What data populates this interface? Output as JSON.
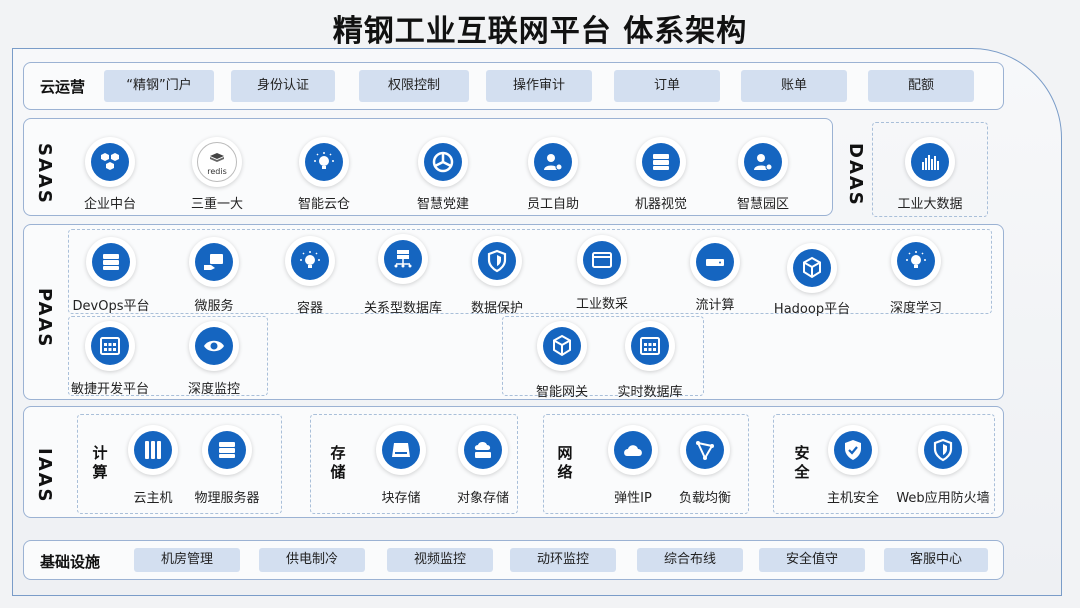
{
  "title": "精钢工业互联网平台  体系架构",
  "cloud_ops": {
    "label": "云运营",
    "items": [
      "“精钢”门户",
      "身份认证",
      "权限控制",
      "操作审计",
      "订单",
      "账单",
      "配额"
    ]
  },
  "saas": {
    "label": "SAAS",
    "items": [
      {
        "label": "企业中台",
        "icon": "hexagons-icon"
      },
      {
        "label": "三重一大",
        "icon": "redis-icon",
        "icon_text": "redis"
      },
      {
        "label": "智能云仓",
        "icon": "lightbulb-icon"
      },
      {
        "label": "智慧党建",
        "icon": "pie-chart-icon"
      },
      {
        "label": "员工自助",
        "icon": "user-gear-icon"
      },
      {
        "label": "机器视觉",
        "icon": "server-icon"
      },
      {
        "label": "智慧园区",
        "icon": "user-gear-icon"
      }
    ]
  },
  "daas": {
    "label": "DAAS",
    "items": [
      {
        "label": "工业大数据",
        "icon": "bar-chart-icon"
      }
    ]
  },
  "paas": {
    "label": "PAAS",
    "row1": [
      {
        "label": "DevOps平台",
        "icon": "server-icon"
      },
      {
        "label": "微服务",
        "icon": "hand-window-icon"
      },
      {
        "label": "容器",
        "icon": "lightbulb-icon"
      },
      {
        "label": "关系型数据库",
        "icon": "network-server-icon"
      },
      {
        "label": "数据保护",
        "icon": "shield-icon"
      },
      {
        "label": "工业数采",
        "icon": "window-icon"
      },
      {
        "label": "流计算",
        "icon": "drive-icon"
      },
      {
        "label": "Hadoop平台",
        "icon": "cube-icon"
      },
      {
        "label": "深度学习",
        "icon": "lightbulb-icon"
      }
    ],
    "row2_left": [
      {
        "label": "敏捷开发平台",
        "icon": "grid-window-icon"
      },
      {
        "label": "深度监控",
        "icon": "eye-icon"
      }
    ],
    "row2_right": [
      {
        "label": "智能网关",
        "icon": "cube-icon"
      },
      {
        "label": "实时数据库",
        "icon": "grid-window-icon"
      }
    ]
  },
  "iaas": {
    "label": "IAAS",
    "groups": [
      {
        "label": "计算",
        "items": [
          {
            "label": "云主机",
            "icon": "server-rack-icon"
          },
          {
            "label": "物理服务器",
            "icon": "server-icon"
          }
        ]
      },
      {
        "label": "存储",
        "items": [
          {
            "label": "块存储",
            "icon": "block-storage-icon"
          },
          {
            "label": "对象存储",
            "icon": "cloud-disk-icon"
          }
        ]
      },
      {
        "label": "网络",
        "items": [
          {
            "label": "弹性IP",
            "icon": "cloud-icon"
          },
          {
            "label": "负载均衡",
            "icon": "triangle-nodes-icon"
          }
        ]
      },
      {
        "label": "安全",
        "items": [
          {
            "label": "主机安全",
            "icon": "shield-check-icon"
          },
          {
            "label": "Web应用防火墙",
            "icon": "shield-icon"
          }
        ]
      }
    ]
  },
  "infra": {
    "label": "基础设施",
    "items": [
      "机房管理",
      "供电制冷",
      "视频监控",
      "动环监控",
      "综合布线",
      "安全值守",
      "客服中心"
    ]
  },
  "colors": {
    "accent": "#1565c0",
    "pill": "#d3dff0",
    "border": "#9bb2d3"
  }
}
